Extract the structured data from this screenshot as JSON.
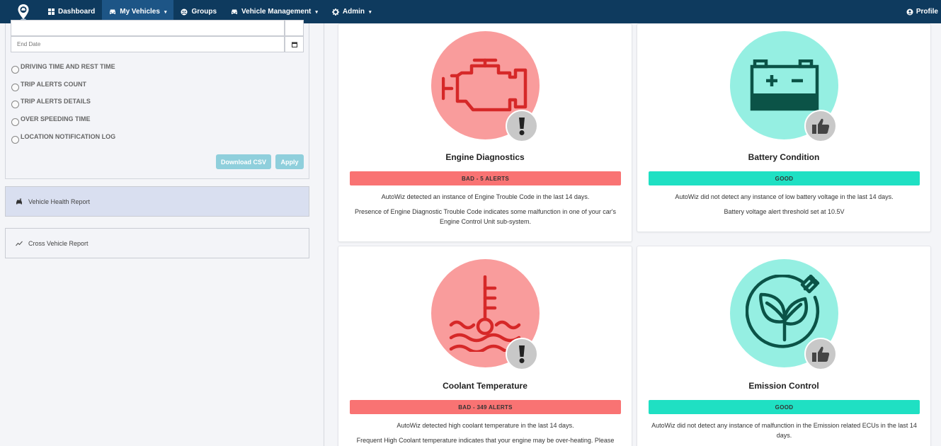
{
  "navbar": {
    "items": [
      {
        "label": "Dashboard",
        "icon": "dashboard-icon",
        "active": false,
        "dropdown": false
      },
      {
        "label": "My Vehicles",
        "icon": "car-icon",
        "active": true,
        "dropdown": true
      },
      {
        "label": "Groups",
        "icon": "groups-icon",
        "active": false,
        "dropdown": false
      },
      {
        "label": "Vehicle Management",
        "icon": "car-icon",
        "active": false,
        "dropdown": true
      },
      {
        "label": "Admin",
        "icon": "gear-icon",
        "active": false,
        "dropdown": true
      }
    ],
    "profile_label": "Profile"
  },
  "left_panel": {
    "end_date_placeholder": "End Date",
    "report_options": [
      "DRIVING TIME AND REST TIME",
      "TRIP ALERTS COUNT",
      "TRIP ALERTS DETAILS",
      "OVER SPEEDING TIME",
      "LOCATION NOTIFICATION LOG"
    ],
    "download_csv_label": "Download CSV",
    "apply_label": "Apply",
    "vehicle_health_report_label": "Vehicle Health Report",
    "cross_vehicle_report_label": "Cross Vehicle Report"
  },
  "cards": {
    "engine": {
      "title": "Engine Diagnostics",
      "status": "BAD - 5 ALERTS",
      "text1": "AutoWiz detected an instance of Engine Trouble Code in the last 14 days.",
      "text2": "Presence of Engine Diagnostic Trouble Code indicates some malfunction in one of your car's Engine Control Unit sub-system."
    },
    "battery": {
      "title": "Battery Condition",
      "status": "GOOD",
      "text1": "AutoWiz did not detect any instance of low battery voltage in the last 14 days.",
      "text2": "Battery voltage alert threshold set at 10.5V"
    },
    "coolant": {
      "title": "Coolant Temperature",
      "status": "BAD - 349 ALERTS",
      "text1": "AutoWiz detected high coolant temperature in the last 14 days.",
      "text2": "Frequent High Coolant temperature indicates that your engine may be over-heating. Please"
    },
    "emission": {
      "title": "Emission Control",
      "status": "GOOD",
      "text1": "AutoWiz did not detect any instance of malfunction in the Emission related ECUs in the last 14 days."
    }
  },
  "colors": {
    "navbar": "#0e3a5e",
    "navbar_active": "#1d5586",
    "bad_circle": "#f99c9c",
    "good_circle": "#95efe2",
    "bad_bar": "#f97373",
    "good_bar": "#1fe0c3",
    "bad_icon_stroke": "#d62828",
    "good_icon_stroke": "#0b5347"
  }
}
